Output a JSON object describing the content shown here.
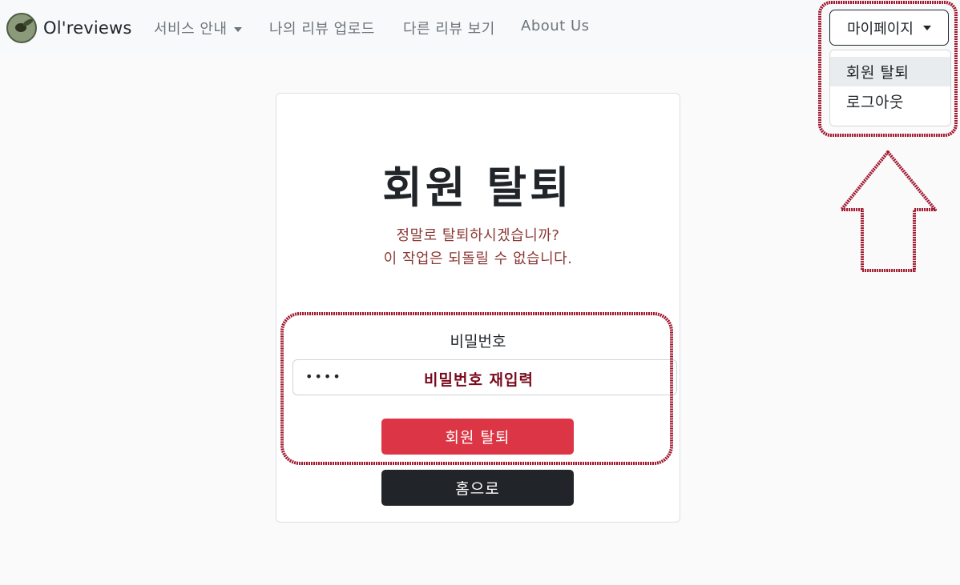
{
  "brand": {
    "name": "Ol'reviews",
    "logo_icon": "olive-logo-icon"
  },
  "nav": {
    "items": [
      {
        "label": "서비스 안내",
        "has_dropdown": true
      },
      {
        "label": "나의 리뷰 업로드"
      },
      {
        "label": "다른 리뷰 보기"
      },
      {
        "label": "About Us"
      }
    ]
  },
  "mypage": {
    "label": "마이페이지",
    "menu": [
      {
        "label": "회원 탈퇴",
        "active": true
      },
      {
        "label": "로그아웃"
      }
    ]
  },
  "main": {
    "title": "회원 탈퇴",
    "warning_line1": "정말로 탈퇴하시겠습니까?",
    "warning_line2": "이 작업은 되돌릴 수 없습니다.",
    "password_label": "비밀번호",
    "password_value": "••••",
    "password_annotation": "비밀번호 재입력",
    "withdraw_button": "회원 탈퇴",
    "home_button": "홈으로"
  },
  "colors": {
    "danger": "#dc3545",
    "dark": "#212529",
    "warning_text": "#8b3a36",
    "annotation": "#a0182e"
  }
}
